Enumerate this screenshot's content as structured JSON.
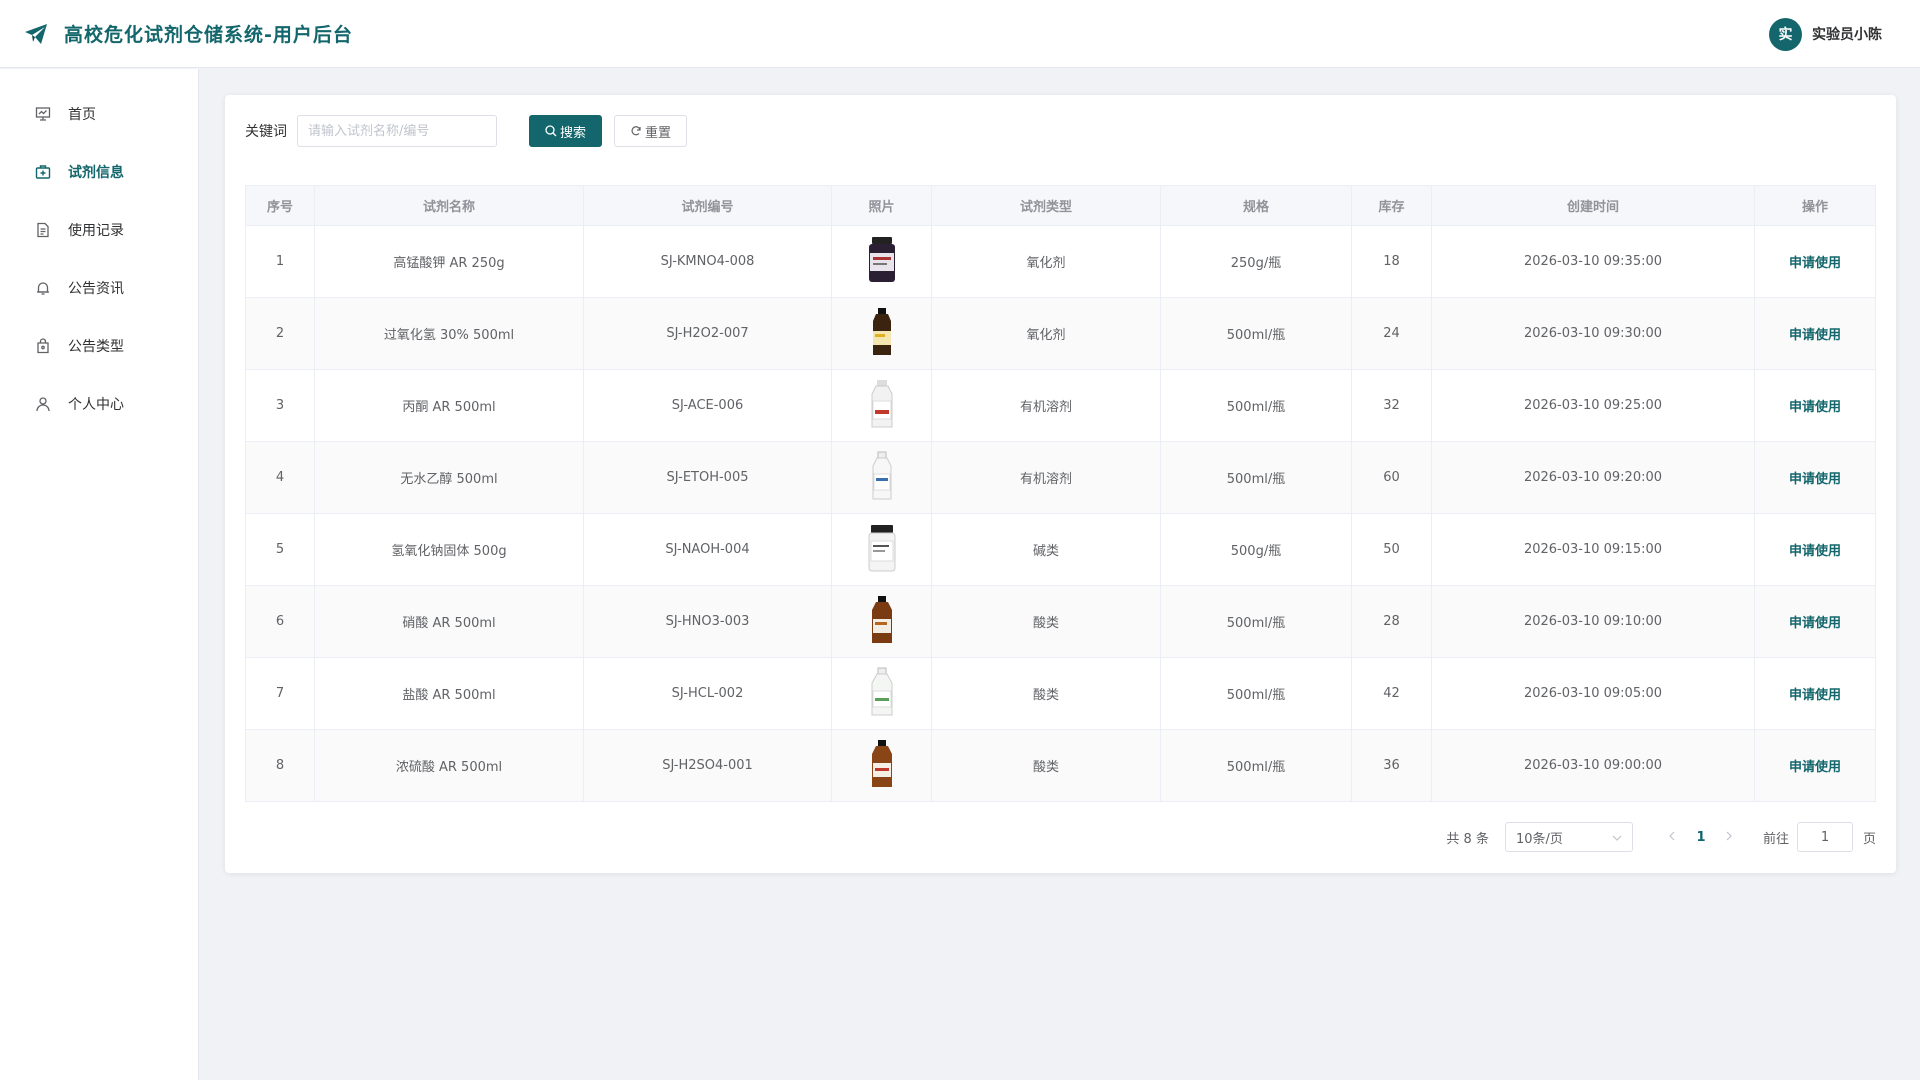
{
  "header": {
    "title": "高校危化试剂仓储系统-用户后台",
    "logo_icon": "paper-plane-icon",
    "user": {
      "avatar_text": "实",
      "name": "实验员小陈"
    }
  },
  "sidebar": {
    "items": [
      {
        "label": "首页",
        "icon": "presentation-icon",
        "active": false
      },
      {
        "label": "试剂信息",
        "icon": "medical-box-icon",
        "active": true
      },
      {
        "label": "使用记录",
        "icon": "document-icon",
        "active": false
      },
      {
        "label": "公告资讯",
        "icon": "bell-icon",
        "active": false
      },
      {
        "label": "公告类型",
        "icon": "lock-bag-icon",
        "active": false
      },
      {
        "label": "个人中心",
        "icon": "user-icon",
        "active": false
      }
    ]
  },
  "search": {
    "label": "关键词",
    "placeholder": "请输入试剂名称/编号",
    "value": "",
    "search_label": "搜索",
    "reset_label": "重置"
  },
  "table": {
    "columns": [
      "序号",
      "试剂名称",
      "试剂编号",
      "照片",
      "试剂类型",
      "规格",
      "库存",
      "创建时间",
      "操作"
    ],
    "rows": [
      {
        "idx": "1",
        "name": "高锰酸钾 AR 250g",
        "code": "SJ-KMNO4-008",
        "photo": "dark-jar",
        "type": "氧化剂",
        "spec": "250g/瓶",
        "stock": "18",
        "created": "2026-03-10 09:35:00",
        "action": "申请使用"
      },
      {
        "idx": "2",
        "name": "过氧化氢 30% 500ml",
        "code": "SJ-H2O2-007",
        "photo": "brown-bottle-yellow",
        "type": "氧化剂",
        "spec": "500ml/瓶",
        "stock": "24",
        "created": "2026-03-10 09:30:00",
        "action": "申请使用"
      },
      {
        "idx": "3",
        "name": "丙酮 AR 500ml",
        "code": "SJ-ACE-006",
        "photo": "clear-bottle-red",
        "type": "有机溶剂",
        "spec": "500ml/瓶",
        "stock": "32",
        "created": "2026-03-10 09:25:00",
        "action": "申请使用"
      },
      {
        "idx": "4",
        "name": "无水乙醇 500ml",
        "code": "SJ-ETOH-005",
        "photo": "clear-bottle-blue",
        "type": "有机溶剂",
        "spec": "500ml/瓶",
        "stock": "60",
        "created": "2026-03-10 09:20:00",
        "action": "申请使用"
      },
      {
        "idx": "5",
        "name": "氢氧化钠固体 500g",
        "code": "SJ-NAOH-004",
        "photo": "white-jar",
        "type": "碱类",
        "spec": "500g/瓶",
        "stock": "50",
        "created": "2026-03-10 09:15:00",
        "action": "申请使用"
      },
      {
        "idx": "6",
        "name": "硝酸 AR 500ml",
        "code": "SJ-HNO3-003",
        "photo": "amber-bottle",
        "type": "酸类",
        "spec": "500ml/瓶",
        "stock": "28",
        "created": "2026-03-10 09:10:00",
        "action": "申请使用"
      },
      {
        "idx": "7",
        "name": "盐酸 AR 500ml",
        "code": "SJ-HCL-002",
        "photo": "clear-bottle-green",
        "type": "酸类",
        "spec": "500ml/瓶",
        "stock": "42",
        "created": "2026-03-10 09:05:00",
        "action": "申请使用"
      },
      {
        "idx": "8",
        "name": "浓硫酸 AR 500ml",
        "code": "SJ-H2SO4-001",
        "photo": "amber-bottle-red",
        "type": "酸类",
        "spec": "500ml/瓶",
        "stock": "36",
        "created": "2026-03-10 09:00:00",
        "action": "申请使用"
      }
    ]
  },
  "pagination": {
    "total_text": "共 8 条",
    "page_size": "10条/页",
    "current_page": "1",
    "goto_label": "前往",
    "goto_value": "1",
    "goto_suffix": "页"
  },
  "colors": {
    "primary": "#13666b",
    "background": "#f0f2f5",
    "border": "#ebeef5"
  }
}
